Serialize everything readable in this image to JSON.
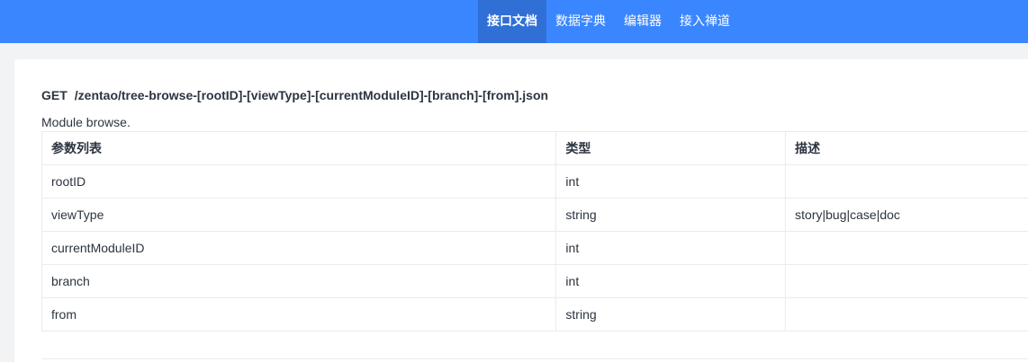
{
  "nav": {
    "items": [
      {
        "label": "接口文档",
        "active": true
      },
      {
        "label": "数据字典",
        "active": false
      },
      {
        "label": "编辑器",
        "active": false
      },
      {
        "label": "接入禅道",
        "active": false
      }
    ]
  },
  "api": {
    "method": "GET",
    "path": "/zentao/tree-browse-[rootID]-[viewType]-[currentModuleID]-[branch]-[from].json",
    "description": "Module browse."
  },
  "params_table": {
    "headers": [
      "参数列表",
      "类型",
      "描述"
    ],
    "rows": [
      [
        "rootID",
        "int",
        ""
      ],
      [
        "viewType",
        "string",
        "story|bug|case|doc"
      ],
      [
        "currentModuleID",
        "int",
        ""
      ],
      [
        "branch",
        "int",
        ""
      ],
      [
        "from",
        "string",
        ""
      ]
    ]
  },
  "colors": {
    "topbar": "#3a86ff",
    "nav_active": "#2f6fd6",
    "page_background": "#f2f3f5"
  }
}
